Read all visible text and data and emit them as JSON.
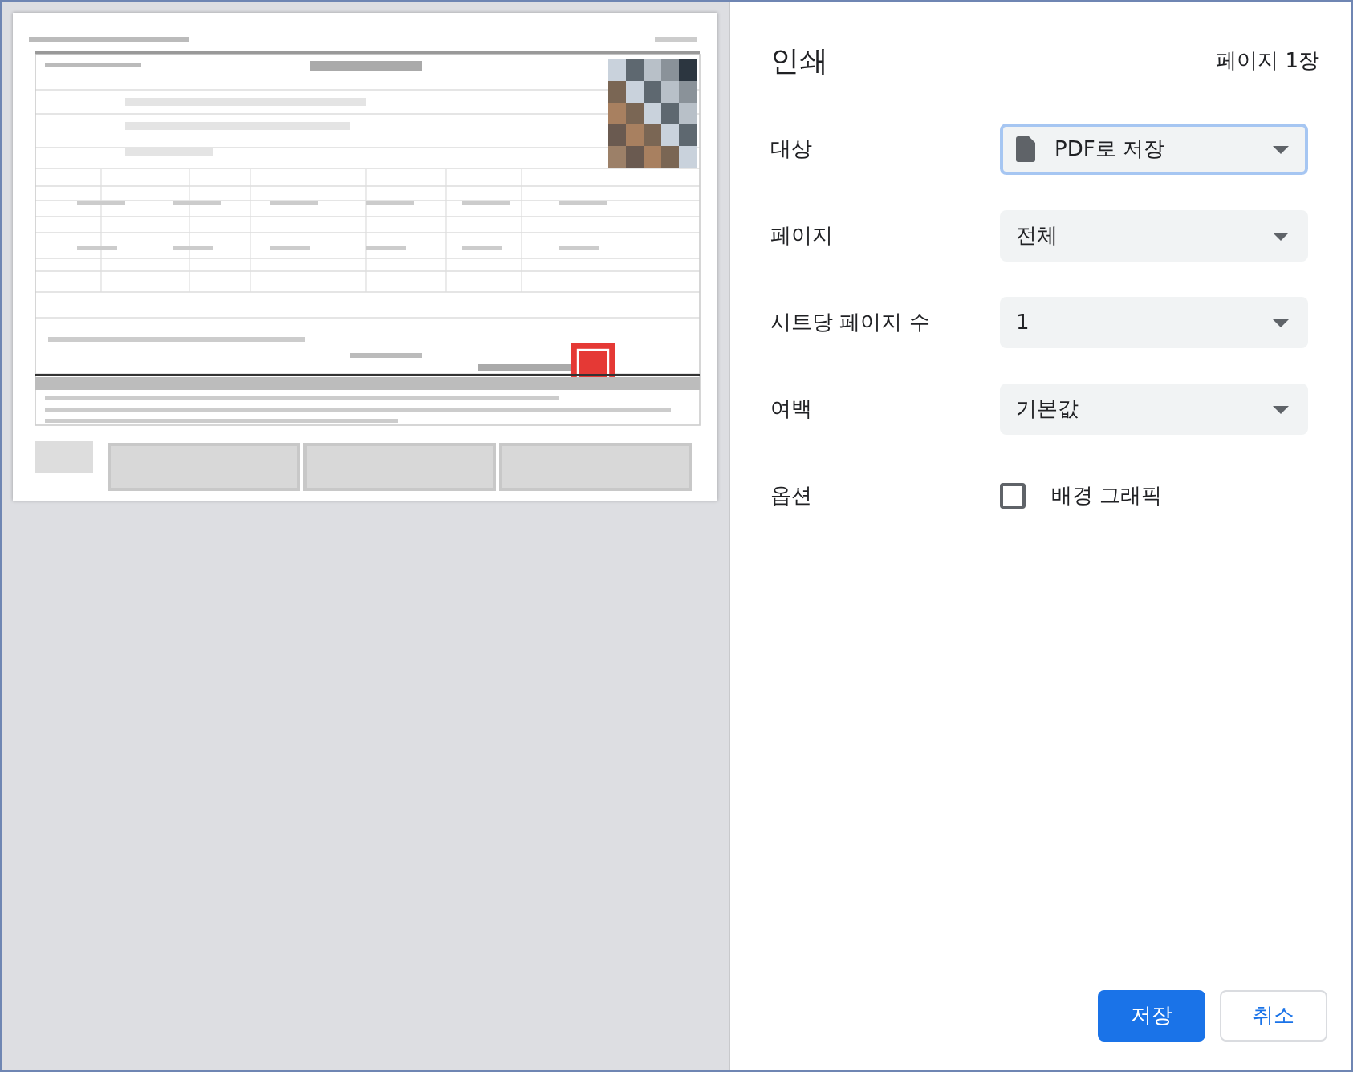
{
  "dialog": {
    "title": "인쇄",
    "page_count": "페이지 1장"
  },
  "settings": [
    {
      "kind": "select",
      "label": "대상",
      "value": "PDF로 저장",
      "focused": true,
      "icon": true
    },
    {
      "kind": "select",
      "label": "페이지",
      "value": "전체",
      "focused": false,
      "icon": false
    },
    {
      "kind": "select",
      "label": "시트당 페이지 수",
      "value": "1",
      "focused": false,
      "icon": false
    },
    {
      "kind": "select",
      "label": "여백",
      "value": "기본값",
      "focused": false,
      "icon": false
    },
    {
      "kind": "checkbox",
      "label": "옵션",
      "value": "배경 그래픽",
      "checked": false
    }
  ],
  "buttons": [
    {
      "label": "저장",
      "kind": "primary"
    },
    {
      "label": "취소",
      "kind": "secondary"
    }
  ]
}
